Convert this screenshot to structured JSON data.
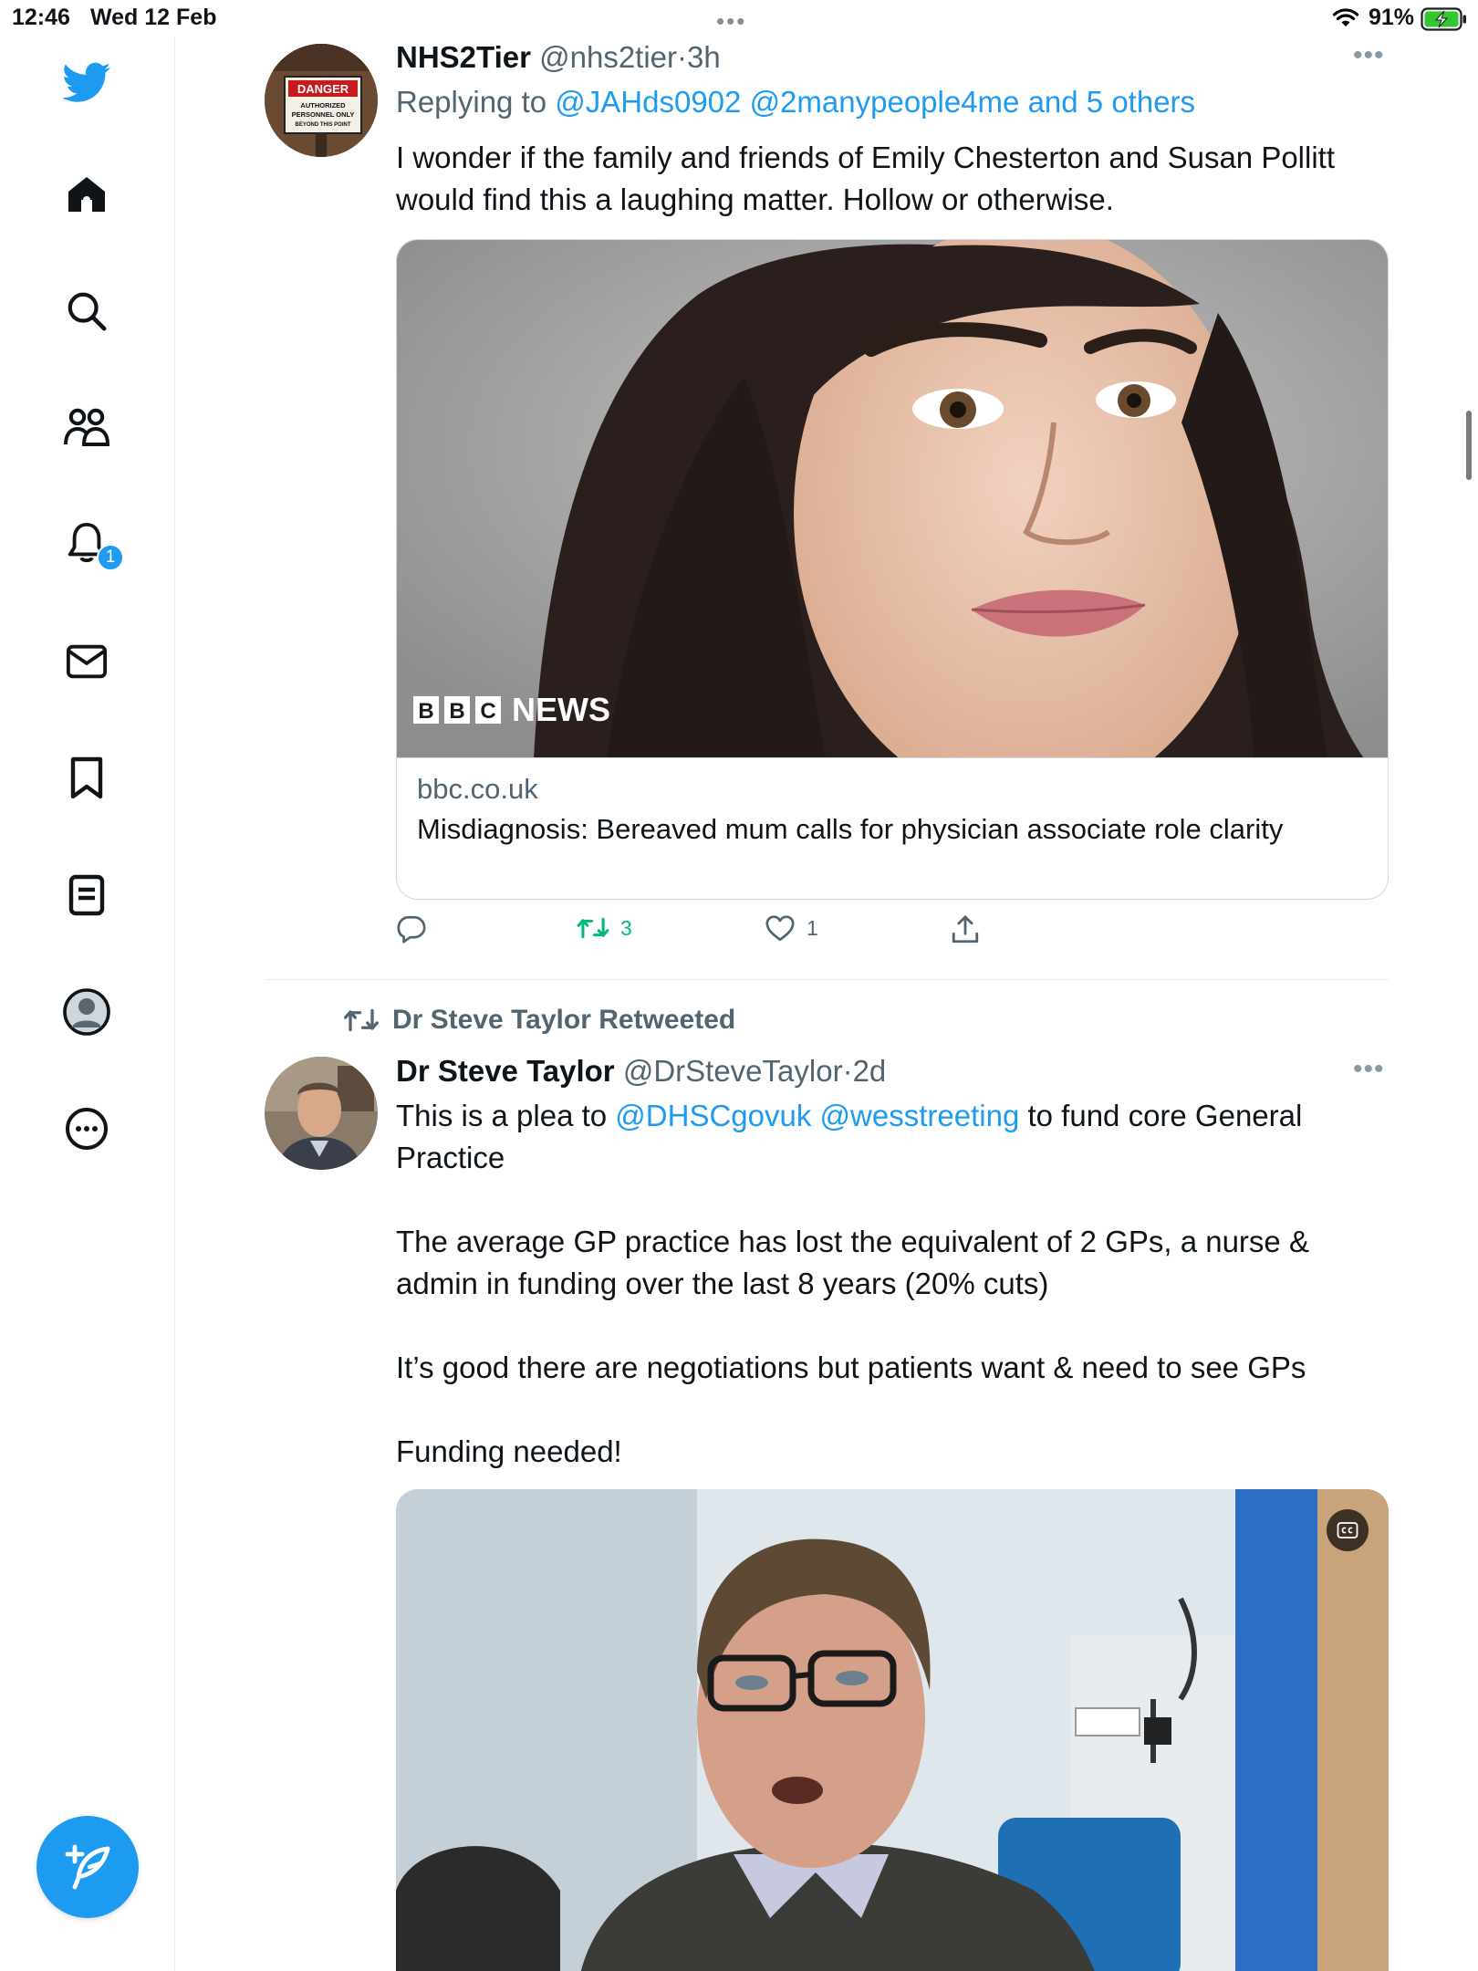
{
  "status_bar": {
    "time": "12:46",
    "date": "Wed 12 Feb",
    "battery": "91%"
  },
  "sidebar": {
    "notification_count": "1",
    "items": [
      {
        "icon": "twitter-bird-icon"
      },
      {
        "icon": "home-icon"
      },
      {
        "icon": "search-icon"
      },
      {
        "icon": "communities-icon"
      },
      {
        "icon": "bell-icon"
      },
      {
        "icon": "mail-icon"
      },
      {
        "icon": "bookmark-icon"
      },
      {
        "icon": "lists-icon"
      },
      {
        "icon": "profile-icon"
      },
      {
        "icon": "more-circle-icon"
      }
    ],
    "compose_icon": "compose-tweet-icon"
  },
  "tweet1": {
    "name": "NHS2Tier",
    "handle": "@nhs2tier",
    "sep": "·",
    "time": "3h",
    "avatar_sign": {
      "line1": "DANGER",
      "line2": "AUTHORIZED",
      "line3": "PERSONNEL ONLY",
      "line4": "BEYOND THIS POINT"
    },
    "replying_prefix": "Replying to",
    "reply_user1": "@JAHds0902",
    "reply_user2": "@2manypeople4me",
    "reply_others": "and 5 others",
    "text_line1": "I wonder if the family and friends of Emily Chesterton and Susan Pollitt",
    "text_line2": "would find this a laughing matter. Hollow or otherwise.",
    "card": {
      "logo_b1": "B",
      "logo_b2": "B",
      "logo_c": "C",
      "logo_news": "NEWS",
      "domain": "bbc.co.uk",
      "title": "Misdiagnosis: Bereaved mum calls for physician associate role clarity"
    },
    "retweets": "3",
    "likes": "1"
  },
  "tweet2": {
    "retweeted_by": "Dr Steve Taylor Retweeted",
    "name": "Dr Steve Taylor",
    "handle": "@DrSteveTaylor",
    "sep": "·",
    "time": "2d",
    "text_prefix": "This is a plea to",
    "mention1": "@DHSCgovuk",
    "mention2": "@wesstreeting",
    "text_suffix": "to fund core General",
    "text_line2": "Practice",
    "para2_line1": "The average GP practice has lost the equivalent of 2 GPs, a nurse &",
    "para2_line2": "admin in funding over the last 8 years (20% cuts)",
    "para3": "It’s good there are negotiations but patients want & need to see GPs",
    "para4": "Funding needed!"
  },
  "colors": {
    "accent": "#1d9bf0",
    "retweet_green": "#00ba7c",
    "text_secondary": "#536471",
    "border": "#cfd9de"
  }
}
